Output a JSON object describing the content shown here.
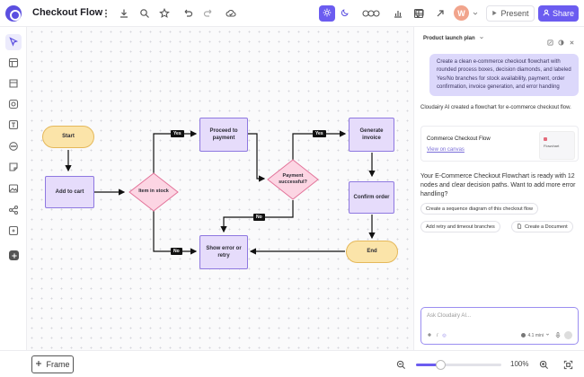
{
  "app": {
    "title": "Checkout Flow",
    "avatar_initial": "W",
    "present_label": "Present",
    "share_label": "Share",
    "accent": "#6b5cf0"
  },
  "toolbar_icons": [
    "more-icon",
    "download-icon",
    "search-icon",
    "star-icon",
    "undo-icon",
    "redo-icon",
    "cloud-icon",
    "sun-icon",
    "moon-icon",
    "collaborators-icon",
    "chart-icon",
    "grid-icon",
    "comment-icon",
    "arrow-icon"
  ],
  "left_tools": [
    "select-tool",
    "frame-tool",
    "section-tool",
    "shape-tool",
    "text-tool",
    "comment-tool",
    "sticky-note-tool",
    "image-tool",
    "connector-tool",
    "embed-tool",
    "add-tool"
  ],
  "flowchart": {
    "nodes": {
      "start": "Start",
      "add_to_cart": "Add to cart",
      "item_in_stock": "Item in stock",
      "proceed_to_payment": "Proceed to payment",
      "payment_successful": "Payment successful?",
      "generate_invoice": "Generate invoice",
      "confirm_order": "Confirm order",
      "end": "End",
      "show_error": "Show error or retry"
    },
    "edges": {
      "yes1": "Yes",
      "yes2": "Yes",
      "no1": "No",
      "no2": "No"
    }
  },
  "bottom": {
    "frame_label": "Frame",
    "zoom_label": "100%",
    "zoom_fraction": 0.28
  },
  "panel": {
    "project": "Product launch plan",
    "user_message": "Create a clean e-commerce checkout flowchart with rounded process boxes, decision diamonds, and labeled Yes/No branches for stock availability, payment, order confirmation, invoice generation, and error handling",
    "ai_message": "Cloudairy AI created a flowchart for e-commerce checkout flow.",
    "card_title": "Commerce Checkout Flow",
    "card_link": "View on canvas",
    "card_thumb_label": "Flowchart",
    "ai_message2": "Your E-Commerce Checkout Flowchart is ready with 12 nodes and clear decision paths. Want to add more error handling?",
    "chips": [
      "Create a sequence diagram of this checkout flow",
      "Add retry and timeout branches",
      "Create a Document"
    ],
    "input_placeholder": "Ask Cloudairy AI...",
    "model_label": "4.1 mini"
  }
}
